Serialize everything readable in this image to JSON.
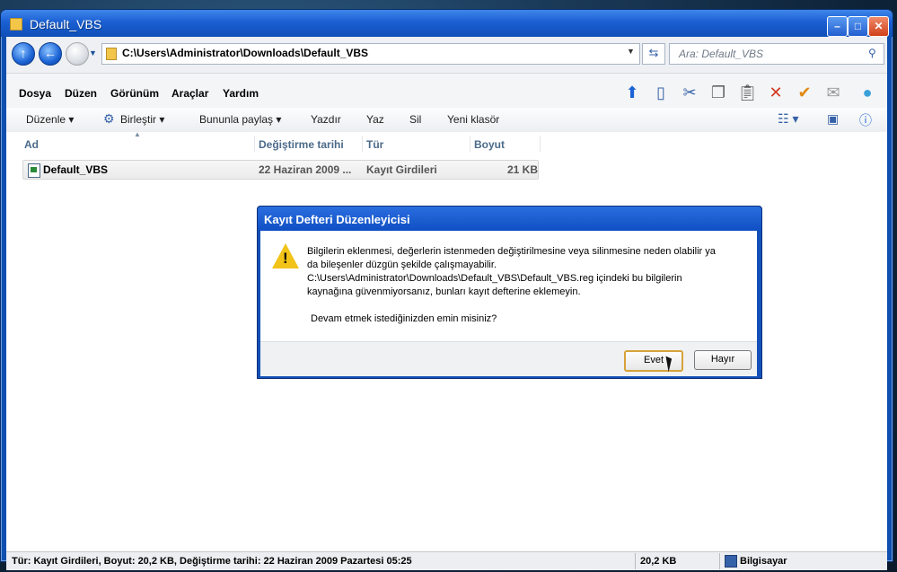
{
  "window": {
    "title": "Default_VBS"
  },
  "address": {
    "path": "C:\\Users\\Administrator\\Downloads\\Default_VBS",
    "search_placeholder": "Ara: Default_VBS"
  },
  "menu": [
    "Dosya",
    "Düzen",
    "Görünüm",
    "Araçlar",
    "Yardım"
  ],
  "toolbar_icons": [
    "up-folder-icon",
    "panel-icon",
    "cut-icon",
    "copy-icon",
    "paste-icon",
    "delete-icon",
    "check-icon",
    "mail-icon",
    "shell-icon"
  ],
  "commands": {
    "organize": "Düzenle",
    "merge": "Birleştir",
    "share": "Bununla paylaş",
    "print": "Yazdır",
    "write": "Yaz",
    "delete": "Sil",
    "new_folder": "Yeni klasör"
  },
  "columns": {
    "name": "Ad",
    "modified": "Değiştirme tarihi",
    "type": "Tür",
    "size": "Boyut"
  },
  "file": {
    "name": "Default_VBS",
    "modified": "22 Haziran 2009 ...",
    "type": "Kayıt Girdileri",
    "size": "21 KB"
  },
  "status": {
    "details": "Tür: Kayıt Girdileri, Boyut: 20,2 KB, Değiştirme tarihi: 22 Haziran 2009 Pazartesi 05:25",
    "size": "20,2 KB",
    "location": "Bilgisayar"
  },
  "dialog": {
    "title": "Kayıt Defteri Düzenleyicisi",
    "message_lines": [
      "Bilgilerin eklenmesi, değerlerin istenmeden değiştirilmesine veya silinmesine neden olabilir ya",
      "da bileşenler düzgün şekilde çalışmayabilir.",
      "C:\\Users\\Administrator\\Downloads\\Default_VBS\\Default_VBS.reg içindeki bu bilgilerin",
      "kaynağına güvenmiyorsanız, bunları kayıt defterine eklemeyin."
    ],
    "question": "Devam etmek istediğinizden emin misiniz?",
    "yes": "Evet",
    "no": "Hayır"
  }
}
